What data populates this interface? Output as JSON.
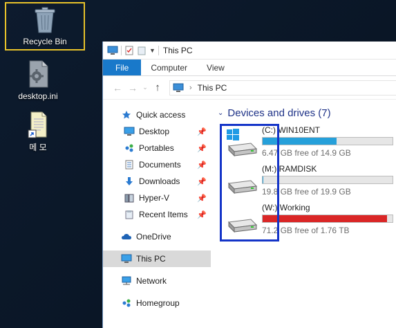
{
  "desktop": {
    "icons": [
      {
        "label": "Recycle Bin",
        "icon": "recycle-bin-icon"
      },
      {
        "label": "desktop.ini",
        "icon": "settings-file-icon"
      },
      {
        "label": "메 모",
        "icon": "text-document-shortcut-icon"
      }
    ]
  },
  "window": {
    "title": "This PC",
    "ribbon_tabs": [
      "File",
      "Computer",
      "View"
    ],
    "address": "This PC",
    "nav": [
      {
        "label": "Quick access",
        "icon": "star-icon"
      },
      {
        "label": "Desktop",
        "icon": "desktop-icon",
        "pinned": true
      },
      {
        "label": "Portables",
        "icon": "network-group-icon",
        "pinned": true
      },
      {
        "label": "Documents",
        "icon": "documents-icon",
        "pinned": true
      },
      {
        "label": "Downloads",
        "icon": "download-arrow-icon",
        "pinned": true
      },
      {
        "label": "Hyper-V",
        "icon": "server-icon",
        "pinned": true
      },
      {
        "label": "Recent Items",
        "icon": "recent-items-icon",
        "pinned": true
      },
      {
        "label": "OneDrive",
        "icon": "cloud-icon"
      },
      {
        "label": "This PC",
        "icon": "computer-icon",
        "selected": true
      },
      {
        "label": "Network",
        "icon": "network-icon"
      },
      {
        "label": "Homegroup",
        "icon": "homegroup-icon"
      }
    ],
    "group": {
      "title": "Devices and drives (7)"
    },
    "drives": [
      {
        "name": "(C:) WIN10ENT",
        "free": "6.47 GB free of 14.9 GB",
        "used_fraction": 0.57,
        "bar_color": "#26a0da",
        "windows_logo": true
      },
      {
        "name": "(M:) RAMDISK",
        "free": "19.8 GB free of 19.9 GB",
        "used_fraction": 0.005,
        "bar_color": "#26a0da",
        "windows_logo": false
      },
      {
        "name": "(W:) Working",
        "free": "71.2 GB free of 1.76 TB",
        "used_fraction": 0.96,
        "bar_color": "#da2626",
        "windows_logo": false
      }
    ]
  }
}
